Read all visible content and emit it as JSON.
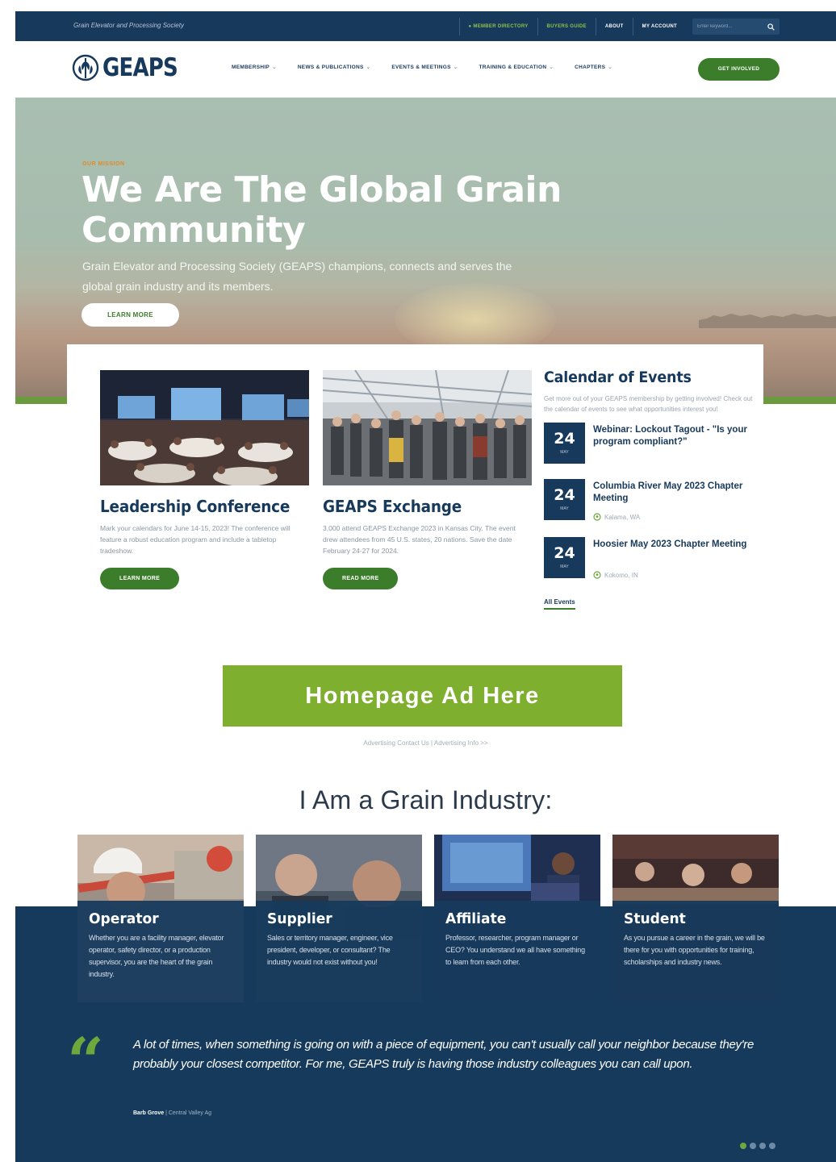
{
  "topbar": {
    "tagline": "Grain Elevator and Processing Society",
    "links": [
      {
        "label": "● Member directory",
        "style": "green"
      },
      {
        "label": "Buyers guide",
        "style": "green"
      },
      {
        "label": "About",
        "style": "white"
      },
      {
        "label": "My account",
        "style": "white"
      }
    ],
    "search_placeholder": "Enter keyword..."
  },
  "nav": {
    "logo_text": "GEAPS",
    "items": [
      "Membership",
      "News & Publications",
      "Events & Meetings",
      "Training & Education",
      "Chapters"
    ],
    "cta": "Get Involved"
  },
  "hero": {
    "eyebrow": "Our Mission",
    "title": "We Are The Global Grain Community",
    "subtitle": "Grain Elevator and Processing Society (GEAPS) champions, connects and serves the global grain industry and its members.",
    "button": "Learn More"
  },
  "features": [
    {
      "title": "Leadership Conference",
      "text": "Mark your calendars for June 14-15, 2023! The conference will feature a robust education program and include a tabletop tradeshow.",
      "button": "Learn More"
    },
    {
      "title": "GEAPS Exchange",
      "text": "3,000 attend GEAPS Exchange 2023 in Kansas City. The event drew attendees from 45 U.S. states, 20 nations. Save the date February 24-27 for 2024.",
      "button": "Read More"
    }
  ],
  "calendar": {
    "heading": "Calendar of Events",
    "intro": "Get more out of your GEAPS membership by getting involved! Check out the calendar of events to see what opportunities interest you!",
    "events": [
      {
        "day": "24",
        "month": "May",
        "title": "Webinar: Lockout Tagout - \"Is your program compliant?\"",
        "location": ""
      },
      {
        "day": "24",
        "month": "May",
        "title": "Columbia River May 2023 Chapter Meeting",
        "location": "Kalama, WA"
      },
      {
        "day": "24",
        "month": "May",
        "title": "Hoosier May 2023 Chapter Meeting",
        "location": "Kokomo, IN"
      }
    ],
    "all_events": "All Events"
  },
  "ad": {
    "label": "Homepage Ad Here",
    "links": "Advertising Contact Us | Advertising Info >>"
  },
  "industry": {
    "heading": "I Am a Grain Industry:",
    "roles": [
      {
        "title": "Operator",
        "text": "Whether you are a facility manager, elevator operator, safety director, or a production supervisor, you are the heart of the grain industry."
      },
      {
        "title": "Supplier",
        "text": "Sales or territory manager, engineer, vice president, developer, or consultant? The industry would not exist without you!"
      },
      {
        "title": "Affiliate",
        "text": "Professor, researcher, program manager or CEO? You understand we all have something to learn from each other."
      },
      {
        "title": "Student",
        "text": "As you pursue a career in the grain, we will be there for you with opportunities for training, scholarships and industry news."
      }
    ]
  },
  "testimonial": {
    "quote": "A lot of times, when something is going on with a piece of equipment, you can't usually call your neighbor because they're probably your closest competitor. For me, GEAPS truly is having those industry colleagues you can call upon.",
    "author": "Barb Grove",
    "company": "| Central Valley Ag"
  },
  "colors": {
    "navy": "#17395c",
    "green": "#3b7d2a",
    "lime": "#7faf2f",
    "accent_orange": "#e08a2c"
  }
}
